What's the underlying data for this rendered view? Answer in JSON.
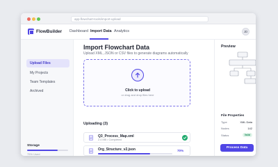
{
  "browser": {
    "url": "app.flowchart-tools/import-upload"
  },
  "app": {
    "name": "FlowBuilder"
  },
  "nav": {
    "items": [
      "Dashboard",
      "Import Data",
      "Analytics"
    ],
    "active": "Import Data",
    "avatar_initials": "JD"
  },
  "sidebar": {
    "items": [
      {
        "label": "Upload Files",
        "active": true
      },
      {
        "label": "My Projects",
        "active": false
      },
      {
        "label": "Team Templates",
        "active": false
      },
      {
        "label": "Archived",
        "active": false
      }
    ],
    "storage_label": "Storage",
    "storage_note": "75% Used",
    "storage_fraction": 0.75
  },
  "main": {
    "title": "Import Flowchart Data",
    "subtitle": "Upload XML, JSON or CSV files to generate diagrams automatically",
    "dropzone": {
      "title": "Click to upload",
      "subtitle": "or drag and drop files here"
    },
    "uploading_heading": "Uploading (3)",
    "files": [
      {
        "name": "Q3_Process_Map.xml",
        "meta": "2.4 MB • Completed",
        "status": "complete"
      },
      {
        "name": "Org_Structure_v2.json",
        "progress_label": "70%",
        "progress": 0.7,
        "status": "uploading"
      }
    ]
  },
  "panel": {
    "preview_title": "Preview",
    "properties_title": "File Properties",
    "properties": [
      {
        "label": "Type",
        "value": "XML Data"
      },
      {
        "label": "Nodes",
        "value": "142"
      },
      {
        "label": "Status",
        "value": "Valid"
      }
    ],
    "process_button": "Process Data"
  },
  "colors": {
    "accent": "#5046e5",
    "success": "#1faa6d",
    "sidebar_active_bg": "#e4e3fb"
  }
}
